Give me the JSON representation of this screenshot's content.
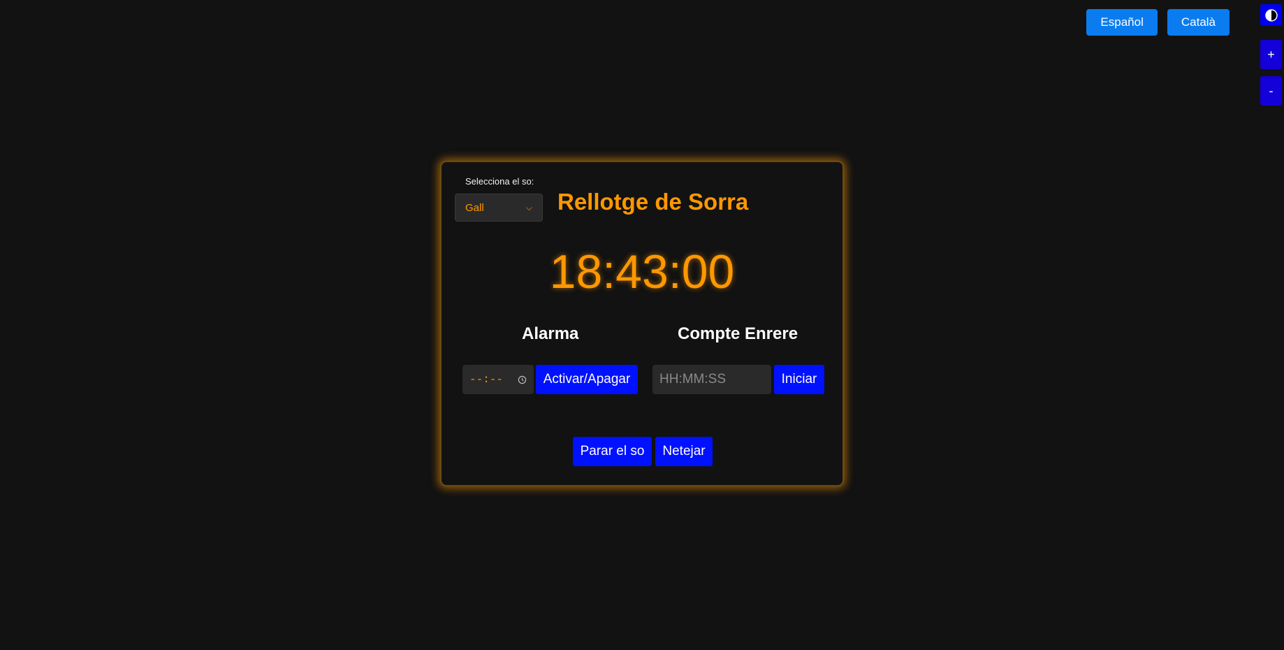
{
  "language_buttons": {
    "spanish": "Español",
    "catalan": "Català"
  },
  "side_tools": {
    "contrast_icon": "half-circle-contrast-icon",
    "zoom_in": "+",
    "zoom_out": "-"
  },
  "sound": {
    "label": "Selecciona el so:",
    "selected": "Gall"
  },
  "title": "Rellotge de Sorra",
  "clock": "18:43:00",
  "alarm": {
    "title": "Alarma",
    "time_value": "--:--",
    "toggle_label": "Activar/Apagar"
  },
  "countdown": {
    "title": "Compte Enrere",
    "placeholder": "HH:MM:SS",
    "start_label": "Iniciar"
  },
  "controls": {
    "stop_label": "Parar el so",
    "clear_label": "Netejar"
  },
  "colors": {
    "accent": "#ff9800",
    "button_blue": "#0011ff",
    "lang_blue": "#0a7cf0",
    "background": "#121212"
  }
}
